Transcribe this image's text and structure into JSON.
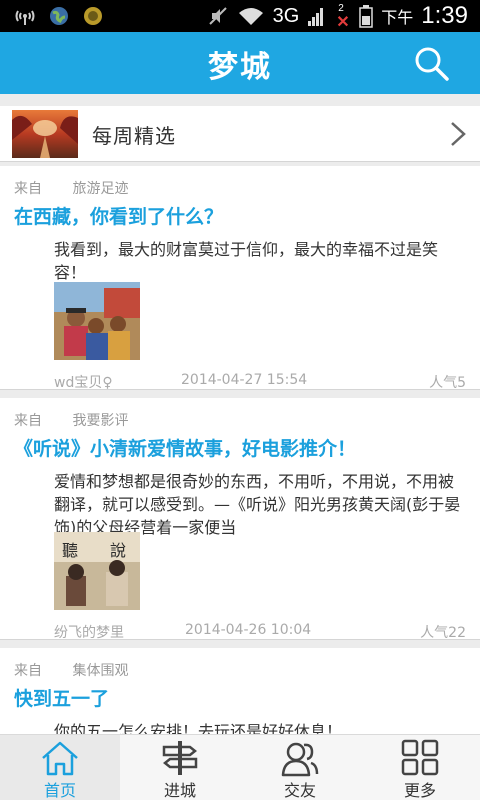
{
  "status_bar": {
    "network": "3G",
    "ampm": "下午",
    "time": "1:39",
    "notification_count": "2"
  },
  "header": {
    "title": "梦城",
    "search_icon": "search-icon"
  },
  "weekly": {
    "label": "每周精选",
    "arrow_icon": "chevron-right-icon"
  },
  "posts": [
    {
      "from_label": "来自",
      "category": "旅游足迹",
      "title": "在西藏，你看到了什么？",
      "body": "我看到，最大的财富莫过于信仰，最大的幸福不过是笑容！",
      "author": "wd宝贝♀",
      "date": "2014-04-27 15:54",
      "popularity": "人气5"
    },
    {
      "from_label": "来自",
      "category": "我要影评",
      "title": "《听说》小清新爱情故事，好电影推介！",
      "body": "爱情和梦想都是很奇妙的东西，不用听，不用说，不用被翻译，就可以感受到。—《听说》阳光男孩黄天阔(彭于晏 饰)的父母经营着一家便当",
      "author": "纷飞的梦里",
      "date": "2014-04-26 10:04",
      "popularity": "人气22"
    },
    {
      "from_label": "来自",
      "category": "集体围观",
      "title": "快到五一了",
      "body": "你的五一怎么安排！去玩还是好好休息！"
    }
  ],
  "bottom_nav": [
    {
      "label": "首页",
      "icon": "home-icon",
      "active": true
    },
    {
      "label": "进城",
      "icon": "signpost-icon",
      "active": false
    },
    {
      "label": "交友",
      "icon": "friends-icon",
      "active": false
    },
    {
      "label": "更多",
      "icon": "grid-icon",
      "active": false
    }
  ],
  "colors": {
    "accent": "#1fa7e2",
    "title_text": "#1ba0dd",
    "meta_text": "#aaaaaa"
  }
}
